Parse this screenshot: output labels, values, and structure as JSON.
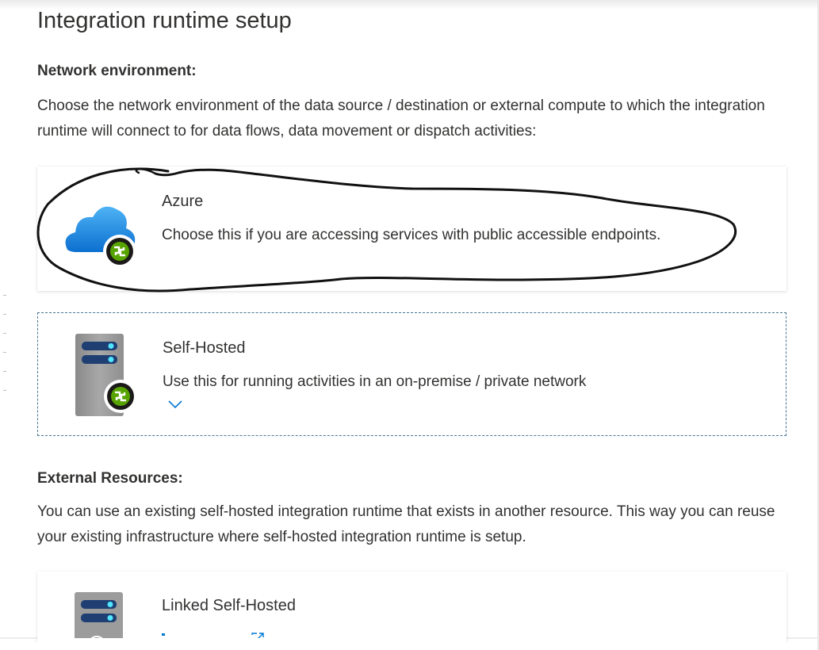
{
  "dialog": {
    "title": "Integration runtime setup"
  },
  "network": {
    "heading": "Network environment:",
    "description": "Choose the network environment of the data source / destination or external compute to which the integration runtime will connect to for data flows, data movement or dispatch activities:"
  },
  "options": [
    {
      "title": "Azure",
      "description": "Choose this if you are accessing services with public accessible endpoints.",
      "icon": "azure-cloud-icon"
    },
    {
      "title": "Self-Hosted",
      "description": "Use this for running activities in an on-premise / private network",
      "icon": "server-icon",
      "expand_icon": "chevron-down-icon"
    }
  ],
  "external": {
    "heading": "External Resources:",
    "description": "You can use an existing self-hosted integration runtime that exists in another resource. This way you can reuse your existing infrastructure where self-hosted integration runtime is setup."
  },
  "linked": {
    "title": "Linked Self-Hosted",
    "icon": "server-icon",
    "link_icon": "external-link-icon"
  },
  "colors": {
    "accent": "#0078d4",
    "selected_border": "#4a7491",
    "runtime_badge": "#57a300",
    "text": "#323130"
  }
}
